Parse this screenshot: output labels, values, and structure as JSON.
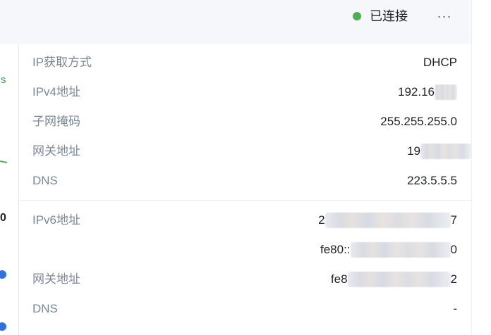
{
  "colors": {
    "status_dot": "#4caf50",
    "top_bar_bg": "#f5f7fa",
    "label_text": "#7c8797",
    "value_text": "#1f2329"
  },
  "header": {
    "status_text": "已连接",
    "more_icon": "more-horizontal-icon",
    "more_glyph": "···"
  },
  "left_panel": {
    "fragment_s": "s",
    "fragment_zero": "0"
  },
  "ipv4_section": {
    "rows": [
      {
        "label": "IP获取方式",
        "value": "DHCP"
      },
      {
        "label": "IPv4地址",
        "value": "192.16"
      },
      {
        "label": "子网掩码",
        "value": "255.255.255.0"
      },
      {
        "label": "网关地址",
        "value": "19"
      },
      {
        "label": "DNS",
        "value": "223.5.5.5"
      }
    ]
  },
  "ipv6_section": {
    "rows": [
      {
        "label": "IPv6地址",
        "value_prefix": "2",
        "value_suffix": "7"
      },
      {
        "label": "",
        "value_prefix": "fe80::",
        "value_suffix": "0"
      },
      {
        "label": "网关地址",
        "value_prefix": "fe8",
        "value_suffix": "2"
      },
      {
        "label": "DNS",
        "value_prefix": "-",
        "value_suffix": ""
      }
    ]
  }
}
